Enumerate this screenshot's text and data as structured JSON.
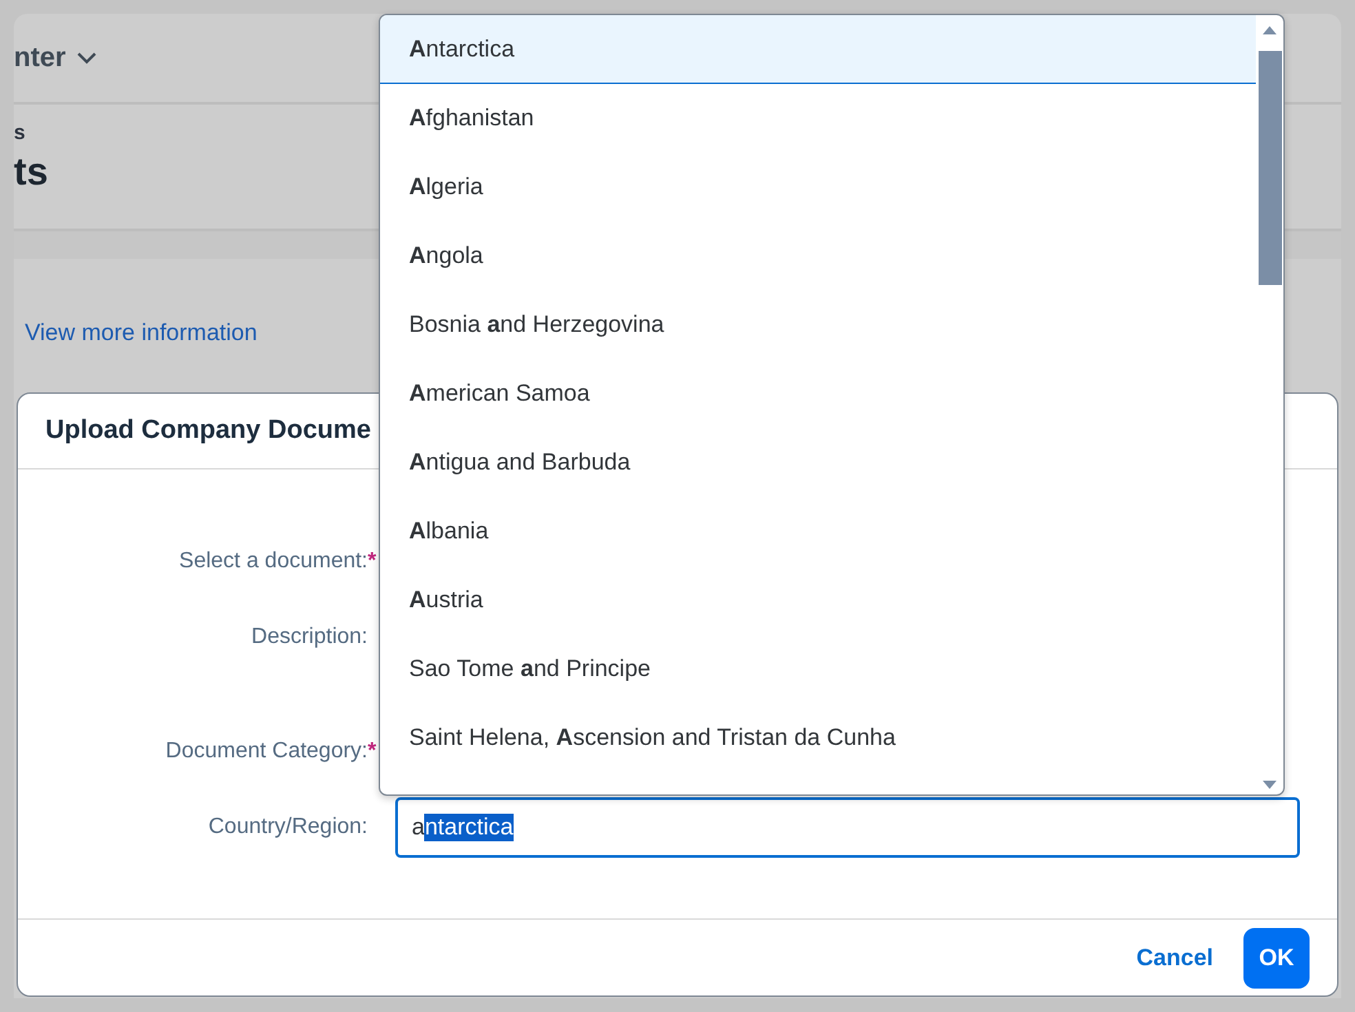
{
  "background": {
    "nav_label": "nter",
    "subtitle": "s",
    "title": "ts",
    "link": "View more information"
  },
  "dialog": {
    "title": "Upload Company Docume",
    "required_marker": "*",
    "fields": [
      {
        "label": "Select a document:",
        "required": true
      },
      {
        "label": "Description:",
        "required": false,
        "kind": "textarea"
      },
      {
        "label": "Document Category:",
        "required": true
      },
      {
        "label": "Country/Region:",
        "required": false,
        "kind": "combo",
        "typed": "a",
        "suggested": "ntarctica"
      }
    ],
    "buttons": [
      {
        "label": "Cancel",
        "kind": "text"
      },
      {
        "label": "OK",
        "kind": "primary"
      }
    ]
  },
  "dropdown": {
    "items": [
      {
        "label": "**A**ntarctica",
        "selected": true
      },
      {
        "label": "**A**fghanistan",
        "selected": false
      },
      {
        "label": "**A**lgeria",
        "selected": false
      },
      {
        "label": "**A**ngola",
        "selected": false
      },
      {
        "label": "Bosnia **a**nd Herzegovina",
        "selected": false
      },
      {
        "label": "**A**merican Samoa",
        "selected": false
      },
      {
        "label": "**A**ntigua and Barbuda",
        "selected": false
      },
      {
        "label": "**A**lbania",
        "selected": false
      },
      {
        "label": "**A**ustria",
        "selected": false
      },
      {
        "label": "Sao Tome **a**nd Principe",
        "selected": false
      },
      {
        "label": "Saint Helena, **A**scension and Tristan da Cunha",
        "selected": false
      }
    ]
  }
}
